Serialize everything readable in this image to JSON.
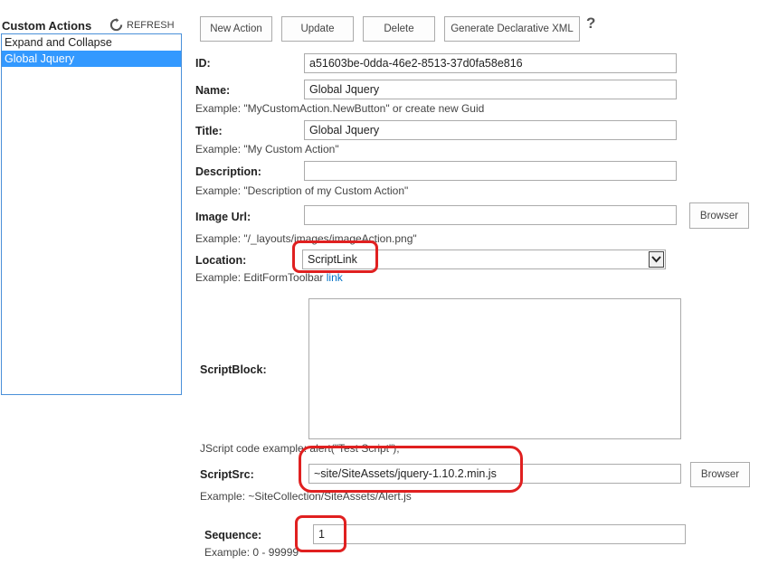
{
  "sidebar": {
    "title": "Custom Actions",
    "refresh_label": "REFRESH",
    "items": [
      {
        "label": "Expand and Collapse"
      },
      {
        "label": "Global Jquery"
      }
    ]
  },
  "toolbar": {
    "new_label": "New Action",
    "update_label": "Update",
    "delete_label": "Delete",
    "xml_label": "Generate Declarative XML",
    "help_label": "?"
  },
  "form": {
    "id": {
      "label": "ID:",
      "value": "a51603be-0dda-46e2-8513-37d0fa58e816"
    },
    "name": {
      "label": "Name:",
      "value": "Global Jquery",
      "example": "Example: \"MyCustomAction.NewButton\" or create new Guid"
    },
    "title": {
      "label": "Title:",
      "value": "Global Jquery",
      "example": "Example: \"My Custom Action\""
    },
    "description": {
      "label": "Description:",
      "value": "",
      "example": "Example: \"Description of my Custom Action\""
    },
    "image_url": {
      "label": "Image Url:",
      "value": "",
      "example": "Example: \"/_layouts/images/imageAction.png\"",
      "browse_label": "Browser"
    },
    "location": {
      "label": "Location:",
      "value": "ScriptLink",
      "example_prefix": "Example: EditFormToolbar ",
      "example_link": "link"
    },
    "script_block": {
      "label": "ScriptBlock:",
      "value": "",
      "example": "JScript code example: alert(\"Test Script\");"
    },
    "script_src": {
      "label": "ScriptSrc:",
      "value": "~site/SiteAssets/jquery-1.10.2.min.js",
      "example": "Example: ~SiteCollection/SiteAssets/Alert.js",
      "browse_label": "Browser"
    },
    "sequence": {
      "label": "Sequence:",
      "value": "1",
      "example": "Example: 0 - 99999"
    }
  },
  "colors": {
    "selection": "#3399ff",
    "highlight": "#e02020",
    "link": "#0072c6"
  }
}
